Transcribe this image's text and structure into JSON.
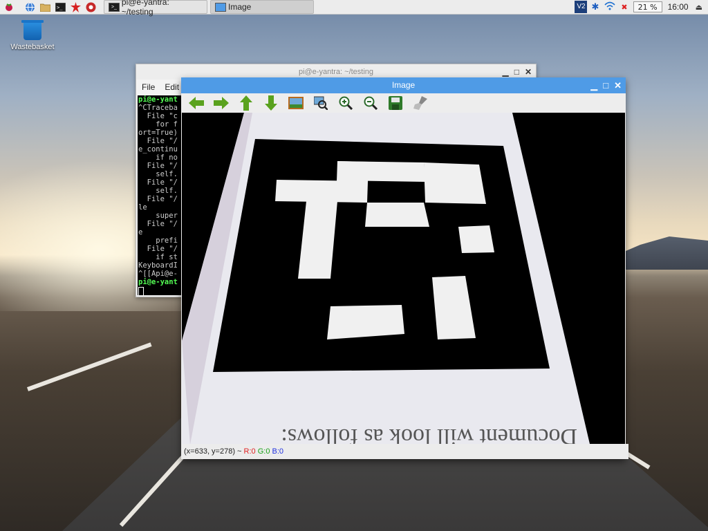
{
  "taskbar": {
    "launchers": [
      "raspberry-menu-icon",
      "web-browser-icon",
      "file-manager-icon",
      "terminal-icon",
      "math-kernel-icon",
      "wolfram-icon"
    ],
    "tasks": [
      {
        "label": "pi@e-yantra: ~/testing"
      },
      {
        "label": "Image"
      }
    ],
    "cpu_usage": "21 %",
    "clock": "16:00",
    "tray_icons": [
      "vnc-icon",
      "bluetooth-icon",
      "wifi-icon",
      "volume-muted-icon",
      "eject-icon"
    ]
  },
  "desktop": {
    "icons": [
      {
        "label": "Wastebasket"
      }
    ]
  },
  "terminal": {
    "title": "pi@e-yantra: ~/testing",
    "menu": [
      "File",
      "Edit"
    ],
    "lines": [
      {
        "text": "pi@e-yant",
        "green": true
      },
      {
        "text": "^CTraceba",
        "green": false
      },
      {
        "text": "  File \"c",
        "green": false
      },
      {
        "text": "    for f",
        "green": false
      },
      {
        "text": "ort=True)",
        "green": false
      },
      {
        "text": "  File \"/",
        "green": false
      },
      {
        "text": "e_continu",
        "green": false
      },
      {
        "text": "    if no",
        "green": false
      },
      {
        "text": "  File \"/",
        "green": false
      },
      {
        "text": "    self.",
        "green": false
      },
      {
        "text": "  File \"/",
        "green": false
      },
      {
        "text": "    self.",
        "green": false
      },
      {
        "text": "  File \"/",
        "green": false
      },
      {
        "text": "le",
        "green": false
      },
      {
        "text": "    super",
        "green": false
      },
      {
        "text": "  File \"/",
        "green": false
      },
      {
        "text": "e",
        "green": false
      },
      {
        "text": "    prefi",
        "green": false
      },
      {
        "text": "  File \"/",
        "green": false
      },
      {
        "text": "    if st",
        "green": false
      },
      {
        "text": "KeyboardI",
        "green": false
      },
      {
        "text": "^[[Api@e-",
        "green": false
      },
      {
        "text": "pi@e-yant",
        "green": true
      }
    ]
  },
  "image_window": {
    "title": "Image",
    "toolbar": [
      "back-arrow-icon",
      "forward-arrow-icon",
      "up-arrow-icon",
      "down-arrow-icon",
      "fit-image-icon",
      "zoom-fit-icon",
      "zoom-in-icon",
      "zoom-out-icon",
      "save-icon",
      "clear-icon"
    ],
    "image_text": "Document will look as follows:",
    "status": {
      "coords": "(x=633, y=278) ~",
      "r": "R:0",
      "g": "G:0",
      "b": "B:0"
    }
  },
  "colors": {
    "title_active": "#4f9be6",
    "terminal_prompt": "#55ff55"
  }
}
